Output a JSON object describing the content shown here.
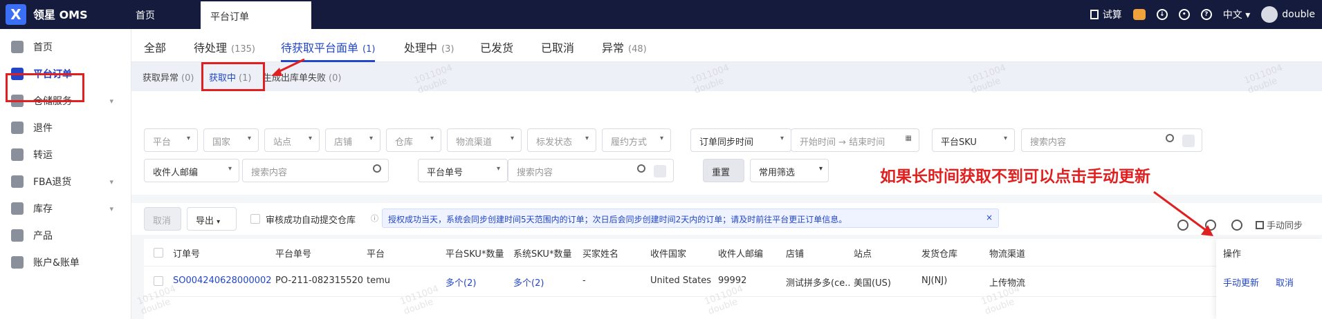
{
  "topbar": {
    "brand": "领星 OMS",
    "tab_home": "首页",
    "tab_active": "平台订单",
    "trial": "试算",
    "language": "中文",
    "username": "double"
  },
  "sidebar": {
    "items": [
      {
        "label": "首页"
      },
      {
        "label": "平台订单"
      },
      {
        "label": "仓储服务"
      },
      {
        "label": "退件"
      },
      {
        "label": "转运"
      },
      {
        "label": "FBA退货"
      },
      {
        "label": "库存"
      },
      {
        "label": "产品"
      },
      {
        "label": "账户&账单"
      }
    ]
  },
  "status_tabs": [
    {
      "label": "全部",
      "count": ""
    },
    {
      "label": "待处理",
      "count": "(135)"
    },
    {
      "label": "待获取平台面单",
      "count": "(1)"
    },
    {
      "label": "处理中",
      "count": "(3)"
    },
    {
      "label": "已发货",
      "count": ""
    },
    {
      "label": "已取消",
      "count": ""
    },
    {
      "label": "异常",
      "count": "(48)"
    }
  ],
  "sub_tabs": [
    {
      "label": "获取异常",
      "count": "(0)"
    },
    {
      "label": "获取中",
      "count": "(1)"
    },
    {
      "label": "生成出库单失败",
      "count": "(0)"
    }
  ],
  "filters": {
    "platform": "平台",
    "country": "国家",
    "site": "站点",
    "shop": "店铺",
    "warehouse": "仓库",
    "logistics": "物流渠道",
    "label_status": "标发状态",
    "fulfill": "履约方式",
    "sync_time": "订单同步时间",
    "start_time": "开始时间",
    "arrow": "→",
    "end_time": "结束时间",
    "sku_type": "平台SKU",
    "search_placeholder": "搜索内容",
    "zip_type": "收件人邮编",
    "order_type": "平台单号",
    "reset": "重置",
    "common": "常用筛选"
  },
  "toolbar": {
    "cancel": "取消",
    "export": "导出",
    "auto_submit": "审核成功自动提交仓库",
    "notice": "授权成功当天，系统会同步创建时间5天范围内的订单；次日后会同步创建时间2天内的订单；请及时前往平台更正订单信息。",
    "notice_close": "×",
    "manual_sync": "手动同步"
  },
  "annotation": "如果长时间获取不到可以点击手动更新",
  "table": {
    "headers": [
      "订单号",
      "平台单号",
      "平台",
      "平台SKU*数量",
      "系统SKU*数量",
      "买家姓名",
      "收件国家",
      "收件人邮编",
      "店铺",
      "站点",
      "发货仓库",
      "物流渠道",
      "操作"
    ],
    "rows": [
      {
        "order_no": "SO004240628000002",
        "platform_no": "PO-211-0823155203...",
        "platform": "temu",
        "platform_sku": "多个(2)",
        "system_sku": "多个(2)",
        "buyer": "-",
        "country": "United States ...",
        "zip": "99992",
        "shop": "测试拼多多(ce...",
        "site": "美国(US)",
        "warehouse": "NJ(NJ)",
        "logistics": "上传物流",
        "op_update": "手动更新",
        "op_cancel": "取消"
      }
    ]
  },
  "watermark": {
    "line1": "1011004",
    "line2": "double"
  },
  "colors": {
    "topbar": "#141b3c",
    "accent": "#2346c8",
    "annotation": "#e02020"
  }
}
